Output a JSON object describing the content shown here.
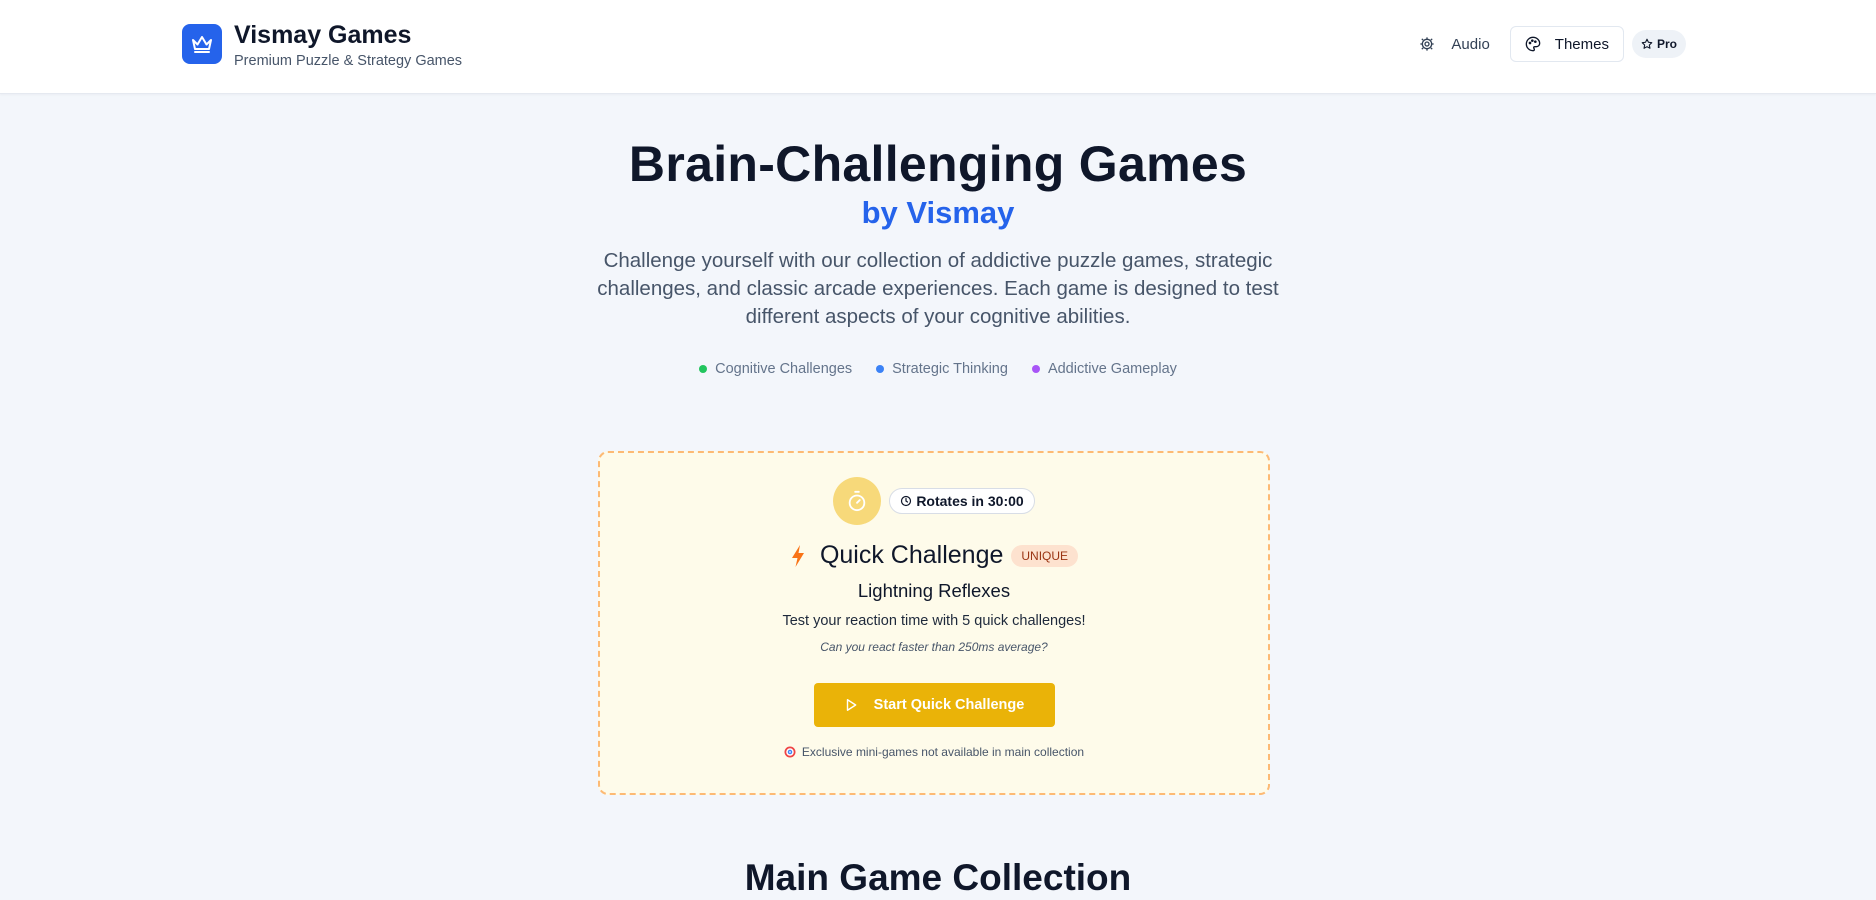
{
  "header": {
    "title": "Vismay Games",
    "subtitle": "Premium Puzzle & Strategy Games",
    "logo_icon": "crown-icon",
    "nav": {
      "audio_label": "Audio",
      "themes_label": "Themes",
      "pro_label": "Pro"
    }
  },
  "hero": {
    "title": "Brain-Challenging Games",
    "byline": "by Vismay",
    "description": "Challenge yourself with our collection of addictive puzzle games, strategic challenges, and classic arcade experiences. Each game is designed to test different aspects of your cognitive abilities.",
    "tags": [
      {
        "label": "Cognitive Challenges",
        "color": "#22c55e"
      },
      {
        "label": "Strategic Thinking",
        "color": "#3b82f6"
      },
      {
        "label": "Addictive Gameplay",
        "color": "#a855f7"
      }
    ]
  },
  "quick_challenge": {
    "rotates_label": "Rotates in 30:00",
    "title": "Quick Challenge",
    "badge": "UNIQUE",
    "game_name": "Lightning Reflexes",
    "description": "Test your reaction time with 5 quick challenges!",
    "hint": "Can you react faster than 250ms average?",
    "button_label": "Start Quick Challenge",
    "note": "Exclusive mini-games not available in main collection"
  },
  "main_collection": {
    "title": "Main Game Collection"
  },
  "colors": {
    "accent": "#2563eb",
    "challenge_button": "#eab308",
    "challenge_border": "#fdba74",
    "challenge_bg": "#fefbea"
  }
}
